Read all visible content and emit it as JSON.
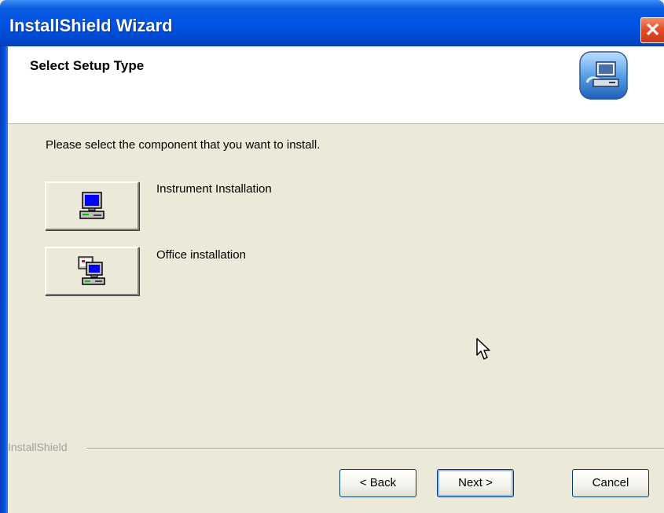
{
  "window": {
    "title": "InstallShield Wizard",
    "close_icon": "close-icon"
  },
  "header": {
    "title": "Select Setup Type",
    "icon": "setup-computer-icon"
  },
  "main": {
    "instructions": "Please select the component that you want to install.",
    "options": [
      {
        "label": "Instrument Installation",
        "icon": "computer-icon"
      },
      {
        "label": "Office installation",
        "icon": "networked-computer-icon"
      }
    ]
  },
  "footer": {
    "brand": "InstallShield",
    "back_label": "< Back",
    "next_label": "Next >",
    "cancel_label": "Cancel"
  },
  "colors": {
    "titlebar": "#0054e3",
    "close": "#e0512b",
    "face": "#ece9d8"
  }
}
